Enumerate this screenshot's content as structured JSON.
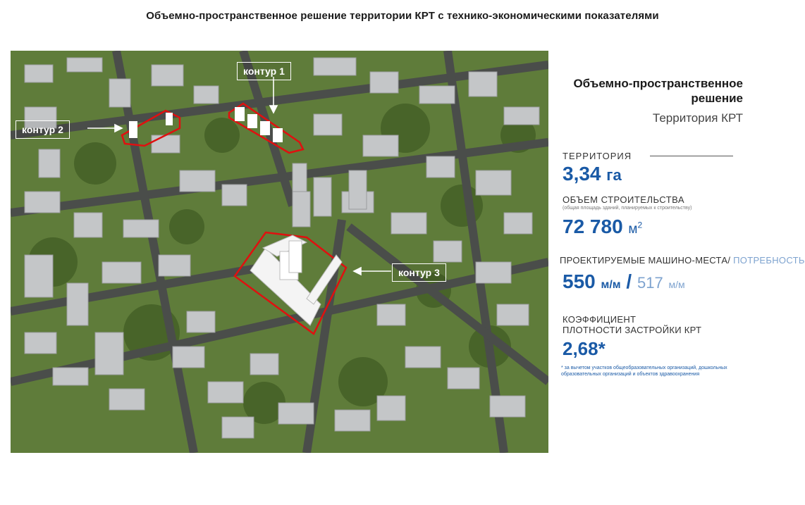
{
  "page_title": "Объемно-пространственное решение территории КРТ  с технико-экономическими показателями",
  "map": {
    "callouts": {
      "contour1": "контур 1",
      "contour2": "контур 2",
      "contour3": "контур 3"
    },
    "colors": {
      "boundary": "#e01010",
      "grass": "#5f7c3a",
      "road": "#4a4d4a",
      "building": "#c4c6c8"
    }
  },
  "panel": {
    "title_line1": "Объемно-пространственное",
    "title_line2": "решение",
    "subtitle": "Территория КРТ",
    "territory_label": "ТЕРРИТОРИЯ",
    "territory_value": "3,34",
    "territory_unit": "га",
    "volume_label": "ОБЪЕМ СТРОИТЕЛЬСТВА",
    "volume_note": "(общая площадь зданий, планируемых к строительству)",
    "volume_value": "72 780",
    "volume_unit": "м",
    "volume_unit_sup": "2",
    "parking_label_a": "ПРОЕКТИРУЕМЫЕ  МАШИНО-МЕСТА/",
    "parking_label_b": " ПОТРЕБНОСТЬ",
    "parking_value": "550",
    "parking_unit": "м/м",
    "parking_sep": " / ",
    "need_value": "517",
    "need_unit": "м/м",
    "density_label_1": "КОЭФФИЦИЕНТ",
    "density_label_2": "ПЛОТНОСТИ ЗАСТРОЙКИ КРТ",
    "density_value": "2,68*",
    "footnote": "* за вычетом участков общеобразовательных организаций, дошкольных образовательных организаций и объектов здравоохранения",
    "colors": {
      "accent": "#1a5aa6",
      "accent_light": "#7ea3cf"
    }
  }
}
